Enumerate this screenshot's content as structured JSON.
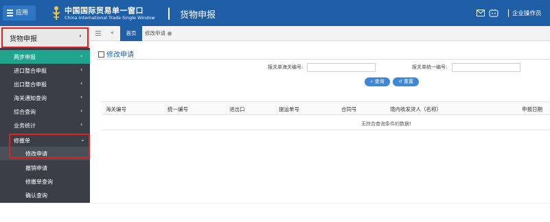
{
  "header": {
    "app_label": "应用",
    "logo_cn": "中国国际贸易单一窗口",
    "logo_en": "China International Trade Single Window",
    "module_title": "货物申报",
    "user_label": "企业操作员"
  },
  "sidebar": {
    "head_label": "货物申报",
    "items": [
      {
        "label": "两步申报",
        "chev": "‹"
      },
      {
        "label": "进口整合申报",
        "chev": "‹"
      },
      {
        "label": "出口整合申报",
        "chev": "‹"
      },
      {
        "label": "海关通知查询",
        "chev": "‹"
      },
      {
        "label": "综合查询",
        "chev": "‹"
      },
      {
        "label": "业务统计",
        "chev": "‹"
      },
      {
        "label": "修撤单",
        "chev": "⌄"
      }
    ],
    "subitems": [
      {
        "label": "修改申请"
      },
      {
        "label": "撤销申请"
      },
      {
        "label": "修撤单查询"
      },
      {
        "label": "确认查询"
      }
    ]
  },
  "tabs": {
    "home_label": "首页",
    "current_label": "修改申请"
  },
  "main": {
    "page_title": "修改申请",
    "customs_no_label": "报关单海关编号:",
    "customs_no_value": "",
    "unified_no_label": "报关单统一编号:",
    "unified_no_value": "",
    "query_button": "查询",
    "reset_button": "重置",
    "table_headers": [
      "海关编号",
      "统一编号",
      "进出口",
      "提运单号",
      "合同号",
      "境内收发货人（名称）",
      "申报日期"
    ],
    "empty_message": "无符合查询条件的数据!"
  },
  "colors": {
    "header_blue": "#1f5fa8",
    "sidebar_dark": "#3a3f47",
    "active_teal": "#1fa58e",
    "button_blue": "#3d87d6",
    "highlight_red": "#e02020"
  }
}
